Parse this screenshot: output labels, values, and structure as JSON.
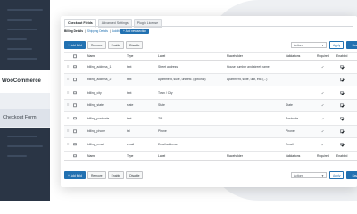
{
  "sidebar": {
    "plugin_label": "WooCommerce",
    "active_item": "Checkout Form"
  },
  "tabs": [
    "Checkout Fields",
    "Advanced Settings",
    "Plugin License"
  ],
  "breadcrumb": {
    "current": "Billing Details",
    "links": [
      "Shipping Details",
      "Additional Details"
    ]
  },
  "add_section_label": "+ Add new section",
  "toolbar": {
    "add_field": "+ Add field",
    "remove": "Remove",
    "enable": "Enable",
    "disable": "Disable",
    "actions_placeholder": "Actions",
    "apply": "Apply",
    "save": "Save"
  },
  "table": {
    "headers": [
      "Name",
      "Type",
      "Label",
      "Placeholder",
      "Validations",
      "Required",
      "Enabled"
    ],
    "rows": [
      {
        "name": "billing_address_1",
        "type": "text",
        "label": "Street address",
        "placeholder": "House number and street name",
        "validations": "",
        "required": true,
        "enabled": true
      },
      {
        "name": "billing_address_2",
        "type": "text",
        "label": "Apartment, suite, unit etc. (optional)",
        "placeholder": "Apartment, suite, unit, etc. (...)",
        "validations": "",
        "required": false,
        "enabled": true
      },
      {
        "name": "billing_city",
        "type": "text",
        "label": "Town / City",
        "placeholder": "",
        "validations": "",
        "required": true,
        "enabled": true
      },
      {
        "name": "billing_state",
        "type": "state",
        "label": "State",
        "placeholder": "",
        "validations": "State",
        "required": true,
        "enabled": true
      },
      {
        "name": "billing_postcode",
        "type": "text",
        "label": "ZIP",
        "placeholder": "",
        "validations": "Postcode",
        "required": true,
        "enabled": true
      },
      {
        "name": "billing_phone",
        "type": "tel",
        "label": "Phone",
        "placeholder": "",
        "validations": "Phone",
        "required": true,
        "enabled": true
      },
      {
        "name": "billing_email",
        "type": "email",
        "label": "Email address",
        "placeholder": "",
        "validations": "Email",
        "required": true,
        "enabled": true
      }
    ]
  }
}
